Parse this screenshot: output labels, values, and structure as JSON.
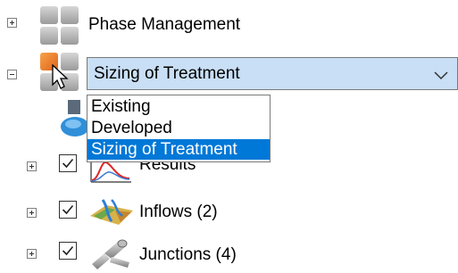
{
  "tree": {
    "phase_management": {
      "label": "Phase Management",
      "icon": "phase-management-icon"
    },
    "sizing": {
      "combo": {
        "selected": "Sizing of Treatment",
        "options": [
          "Existing",
          "Developed",
          "Sizing of Treatment"
        ],
        "selected_index": 2
      }
    },
    "results": {
      "label": "Results",
      "checked": true,
      "icon": "results-chart-icon"
    },
    "inflows": {
      "label": "Inflows (2)",
      "checked": true,
      "icon": "inflows-icon"
    },
    "junctions": {
      "label": "Junctions (4)",
      "checked": true,
      "icon": "junctions-pipe-icon"
    }
  },
  "colors": {
    "selection": "#0078d7",
    "combo_highlight": "#c9dff5"
  }
}
